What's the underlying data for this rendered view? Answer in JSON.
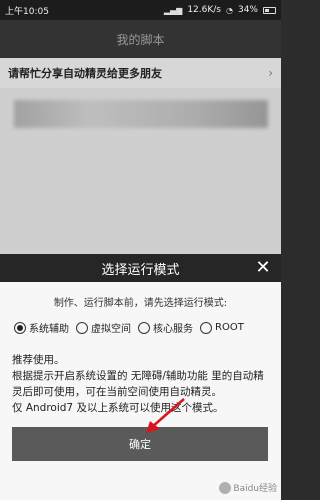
{
  "status_bar": {
    "time": "上午10:05",
    "speed": "12.6K/s",
    "battery": "34%"
  },
  "app": {
    "title": "我的脚本"
  },
  "banner": {
    "text": "请帮忙分享自动精灵给更多朋友",
    "chevron": "›"
  },
  "dialog": {
    "title": "选择运行模式",
    "close": "✕",
    "prompt": "制作、运行脚本前，请先选择运行模式:",
    "modes": [
      {
        "label": "系统辅助",
        "checked": true
      },
      {
        "label": "虚拟空间",
        "checked": false
      },
      {
        "label": "核心服务",
        "checked": false
      },
      {
        "label": "ROOT",
        "checked": false
      }
    ],
    "recommend": "推荐使用。",
    "desc1": "根据提示开启系统设置的 无障碍/辅助功能 里的自动精灵后即可使用，可在当前空间使用自动精灵。",
    "desc2": "仅 Android7 及以上系统可以使用这个模式。",
    "confirm": "确定"
  },
  "watermark": {
    "text": "Baidu经验"
  },
  "colors": {
    "arrow": "#d8141c"
  }
}
